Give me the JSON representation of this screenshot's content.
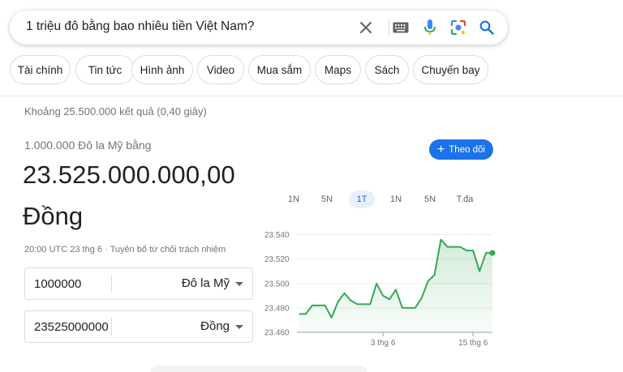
{
  "search": {
    "query": "1 triệu đô bằng bao nhiêu tiền Việt Nam?",
    "icons": [
      "close-icon",
      "keyboard-icon",
      "mic-icon",
      "lens-icon",
      "search-icon"
    ]
  },
  "chips": [
    "Tài chính",
    "Tin tức",
    "Hình ảnh",
    "Video",
    "Mua sắm",
    "Maps",
    "Sách",
    "Chuyến bay"
  ],
  "result_stats": "Khoảng 25.500.000 kết quả (0,40 giây)",
  "converter": {
    "from_label": "1.000.000 Đô la Mỹ bằng",
    "amount": "23.525.000.000,00",
    "unit": "Đồng",
    "timestamp": "20:00 UTC 23 thg 6 · Tuyên bố từ chối trách nhiệm",
    "follow_label": "Theo dõi",
    "from_value": "1000000",
    "from_currency": "Đô la Mỹ",
    "to_value": "23525000000",
    "to_currency": "Đồng"
  },
  "range_tabs": [
    "1N",
    "5N",
    "1T",
    "1N",
    "5N",
    "T.đa"
  ],
  "active_range": "1T",
  "colors": {
    "accent": "#1a73e8",
    "line": "#34a853",
    "fill": "#e6f4ea"
  },
  "chart_data": {
    "type": "area",
    "ylim": [
      23460,
      23545
    ],
    "yticks": [
      "23.540",
      "23.520",
      "23.500",
      "23.480",
      "23.460"
    ],
    "ytick_values": [
      23540,
      23520,
      23500,
      23480,
      23460
    ],
    "xticks": [
      "3 thg 6",
      "15 thg 6"
    ],
    "xtick_index": [
      13,
      27
    ],
    "values": [
      23475,
      23475,
      23482,
      23482,
      23482,
      23472,
      23485,
      23492,
      23486,
      23483,
      23483,
      23483,
      23500,
      23490,
      23487,
      23495,
      23480,
      23480,
      23480,
      23488,
      23502,
      23507,
      23536,
      23530,
      23530,
      23530,
      23527,
      23527,
      23510,
      23525,
      23525
    ]
  }
}
